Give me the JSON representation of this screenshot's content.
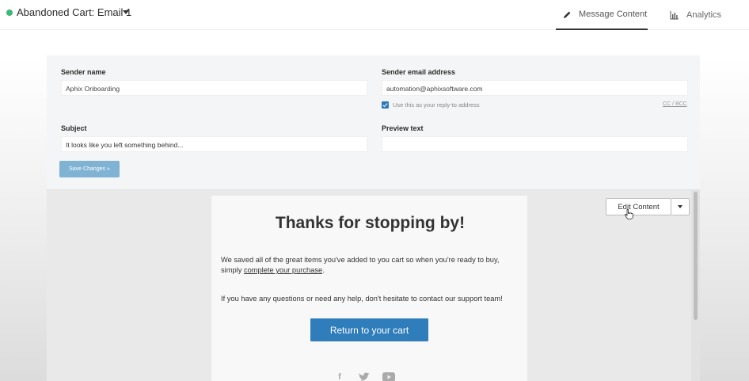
{
  "header": {
    "campaign_title": "Abandoned Cart: Email 1",
    "tabs": [
      {
        "label": "Message Content",
        "icon": "pencil-icon",
        "active": true
      },
      {
        "label": "Analytics",
        "icon": "bar-chart-icon",
        "active": false
      }
    ],
    "status_color": "#3cb878"
  },
  "settings": {
    "sender_name_label": "Sender name",
    "sender_name_value": "Aphix Onboarding",
    "sender_email_label": "Sender email address",
    "sender_email_value": "automation@aphixsoftware.com",
    "reply_to_checkbox_label": "Use this as your reply-to address",
    "reply_to_checked": true,
    "cc_bcc_label": "CC / BCC",
    "subject_label": "Subject",
    "subject_value": "It looks like you left something behind...",
    "preview_text_label": "Preview text",
    "preview_text_value": "",
    "save_button_label": "Save Changes »"
  },
  "preview": {
    "edit_button_label": "Edit Content",
    "email": {
      "heading": "Thanks for stopping by!",
      "paragraph1_line1": "We saved all of the great items you've added to you cart so when you're ready to buy,",
      "paragraph1_line2_prefix": "simply ",
      "paragraph1_link": "complete your purchase",
      "paragraph1_suffix": ".",
      "paragraph2": "If you have any questions or need any help, don't hesitate to contact our support team!",
      "cta_label": "Return to your cart",
      "social_icons": [
        "facebook-icon",
        "twitter-icon",
        "youtube-icon"
      ]
    }
  },
  "colors": {
    "accent": "#2f7dbb",
    "save_button": "#7fb2d3"
  }
}
